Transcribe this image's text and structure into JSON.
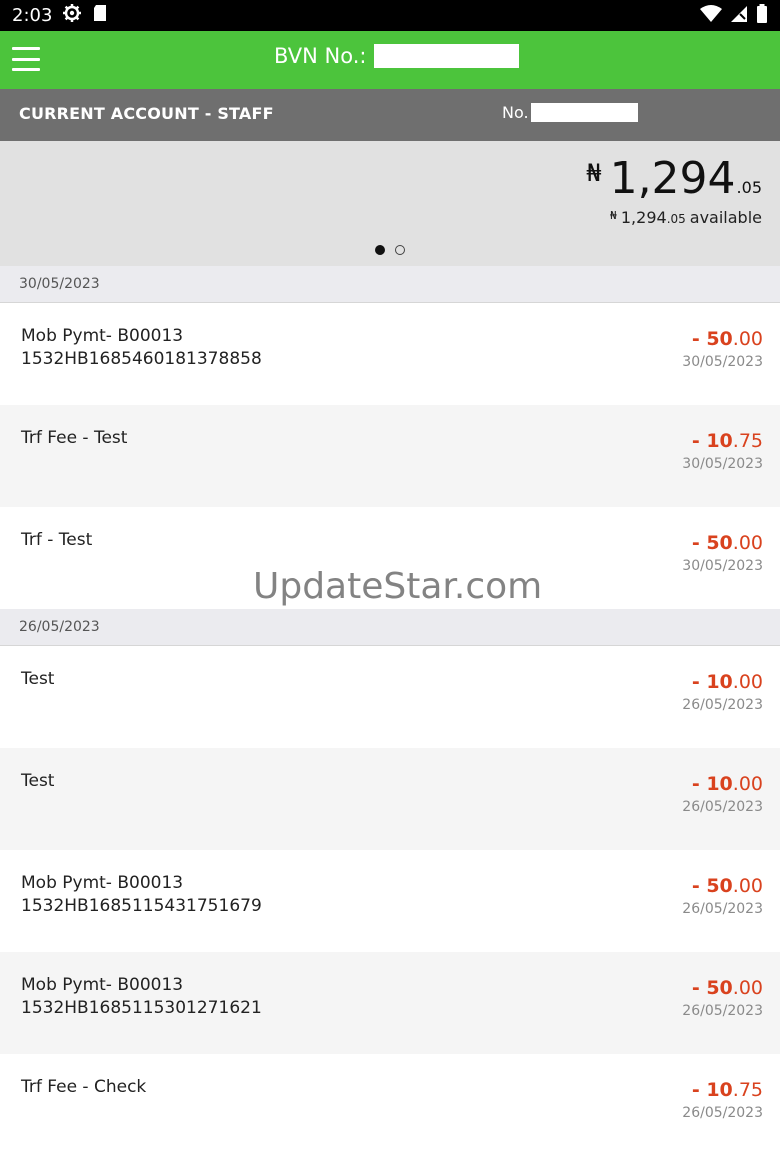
{
  "status_bar": {
    "time": "2:03",
    "icons": [
      "settings-gear-icon",
      "sd-card-icon",
      "wifi-icon",
      "cellular-signal-icon",
      "battery-icon"
    ]
  },
  "app_bar": {
    "bvn_label": "BVN No.:",
    "menu_icon": "hamburger-menu-icon",
    "accent_color": "#4cc43c"
  },
  "account": {
    "name": "CURRENT ACCOUNT - STAFF",
    "number_label": "No."
  },
  "balance": {
    "currency_symbol": "₦",
    "integer": "1,294",
    "decimal": ".05",
    "available_integer": "1,294",
    "available_decimal": ".05",
    "available_label": "available",
    "pager_pages": 2,
    "pager_active": 1
  },
  "groups": [
    {
      "date": "30/05/2023",
      "transactions": [
        {
          "line1": "Mob Pymt- B00013",
          "line2": "1532HB1685460181378858",
          "amount_int": "- 50",
          "amount_dec": ".00",
          "date": "30/05/2023"
        },
        {
          "line1": "Trf Fee - Test",
          "line2": "",
          "amount_int": "- 10",
          "amount_dec": ".75",
          "date": "30/05/2023"
        },
        {
          "line1": "Trf - Test",
          "line2": "",
          "amount_int": "- 50",
          "amount_dec": ".00",
          "date": "30/05/2023"
        }
      ]
    },
    {
      "date": "26/05/2023",
      "transactions": [
        {
          "line1": "Test",
          "line2": "",
          "amount_int": "- 10",
          "amount_dec": ".00",
          "date": "26/05/2023"
        },
        {
          "line1": "Test",
          "line2": "",
          "amount_int": "- 10",
          "amount_dec": ".00",
          "date": "26/05/2023"
        },
        {
          "line1": "Mob Pymt- B00013",
          "line2": "1532HB1685115431751679",
          "amount_int": "- 50",
          "amount_dec": ".00",
          "date": "26/05/2023"
        },
        {
          "line1": "Mob Pymt- B00013",
          "line2": "1532HB1685115301271621",
          "amount_int": "- 50",
          "amount_dec": ".00",
          "date": "26/05/2023"
        },
        {
          "line1": "Trf Fee - Check",
          "line2": "",
          "amount_int": "- 10",
          "amount_dec": ".75",
          "date": "26/05/2023"
        }
      ]
    }
  ],
  "debit_color": "#d9421e",
  "watermark": "UpdateStar.com"
}
